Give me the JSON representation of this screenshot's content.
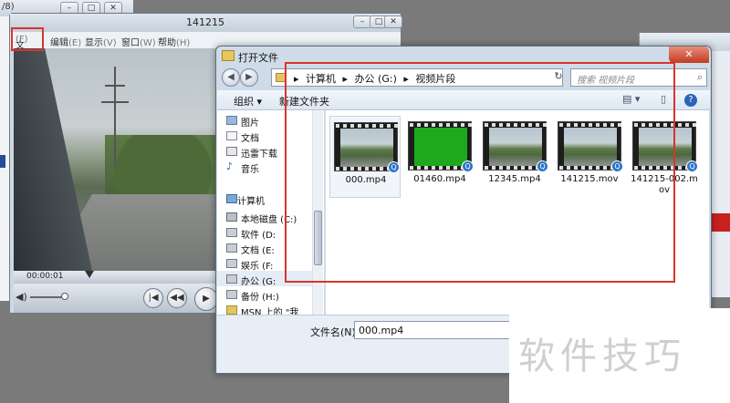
{
  "bg_window": {
    "title_fragment": "/8)"
  },
  "player": {
    "title": "141215",
    "menu": {
      "file": "文件",
      "file_key": "(F)",
      "edit": "编辑",
      "edit_key": "(E)",
      "view": "显示",
      "view_key": "(V)",
      "window": "窗口",
      "window_key": "(W)",
      "help": "帮助",
      "help_key": "(H)"
    },
    "time": "00:00:01"
  },
  "dialog": {
    "title": "打开文件",
    "breadcrumb": [
      "计算机",
      "办公 (G:)",
      "视频片段"
    ],
    "search_placeholder": "搜索 视频片段",
    "toolbar": {
      "organize": "组织 ▾",
      "new_folder": "新建文件夹"
    },
    "nav": {
      "favorites": [
        {
          "label": "图片"
        },
        {
          "label": "文档"
        },
        {
          "label": "迅雷下载"
        },
        {
          "label": "音乐"
        }
      ],
      "computer": "计算机",
      "drives": [
        {
          "label": "本地磁盘 (C:)"
        },
        {
          "label": "软件 (D:"
        },
        {
          "label": "文档 (E:"
        },
        {
          "label": "娱乐 (F:"
        },
        {
          "label": "办公 (G:"
        },
        {
          "label": "备份 (H:)"
        },
        {
          "label": "MSN 上的 \"我"
        }
      ]
    },
    "files": [
      {
        "name": "000.mp4",
        "thumb": "road"
      },
      {
        "name": "01460.mp4",
        "thumb": "green"
      },
      {
        "name": "12345.mp4",
        "thumb": "road"
      },
      {
        "name": "141215.mov",
        "thumb": "road"
      },
      {
        "name": "141215-002.mov",
        "thumb": "road"
      }
    ],
    "filename_label": "文件名(N):",
    "filename_value": "000.mp4"
  },
  "watermark": "软件技巧",
  "colors": {
    "highlight": "#d9342b",
    "accent": "#2c74c9"
  }
}
